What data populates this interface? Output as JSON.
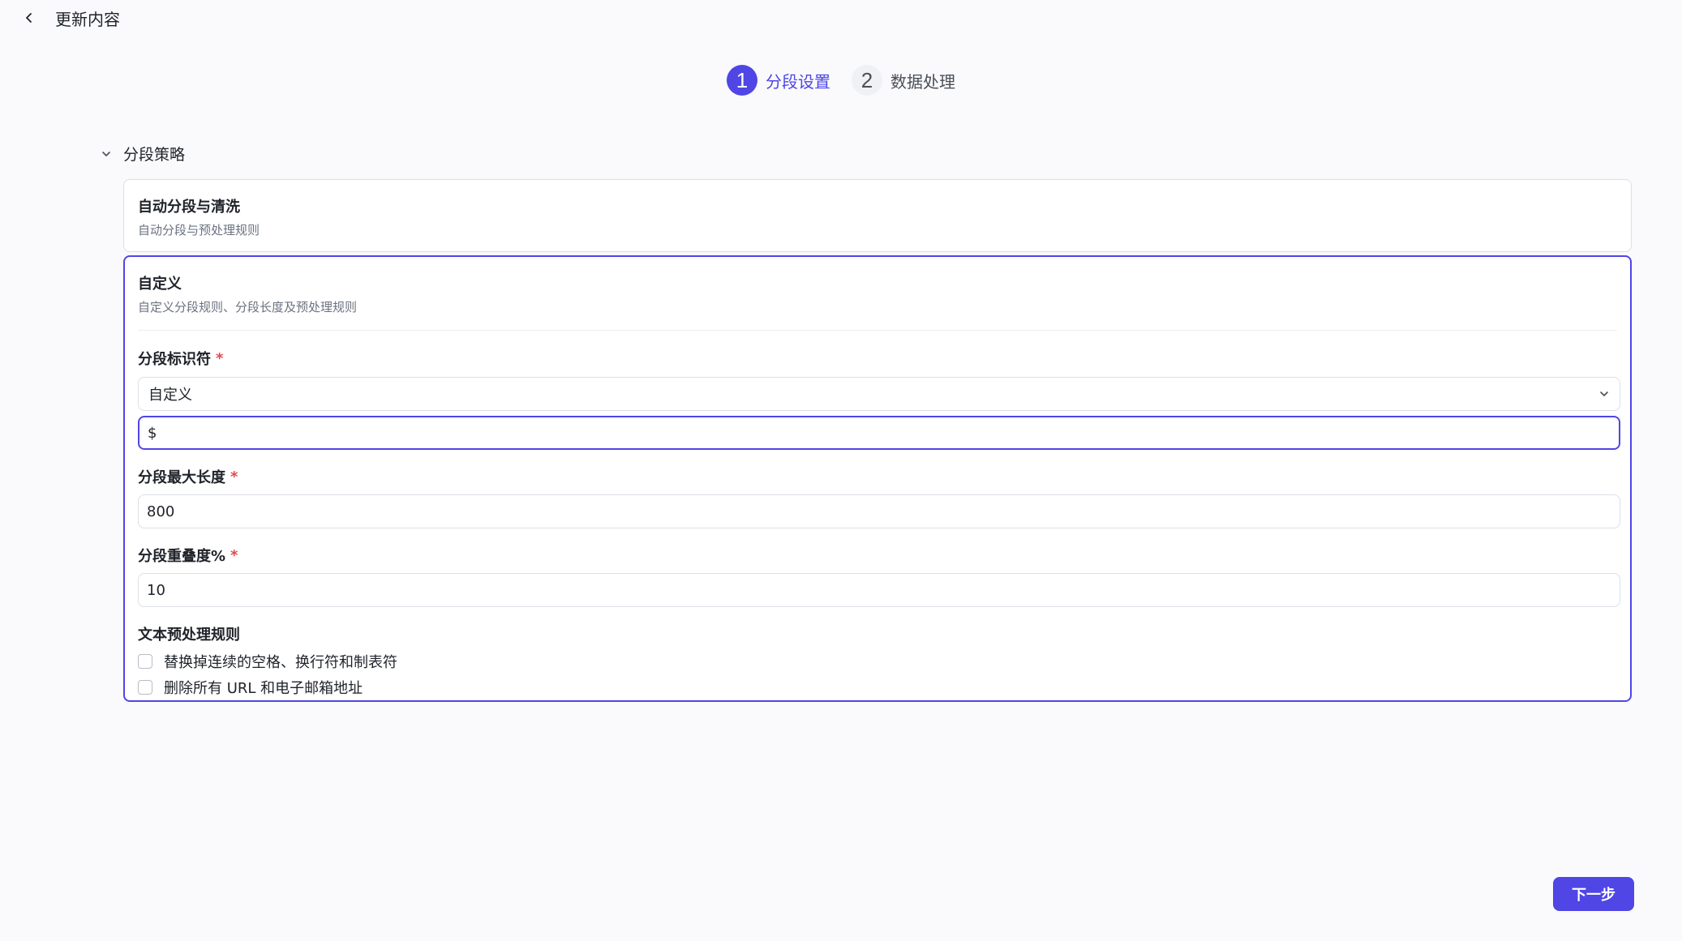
{
  "header": {
    "title": "更新内容"
  },
  "steps": [
    {
      "number": "1",
      "label": "分段设置",
      "state": "active"
    },
    {
      "number": "2",
      "label": "数据处理",
      "state": "inactive"
    }
  ],
  "section": {
    "title": "分段策略"
  },
  "options": {
    "auto": {
      "title": "自动分段与清洗",
      "description": "自动分段与预处理规则"
    },
    "custom": {
      "title": "自定义",
      "description": "自定义分段规则、分段长度及预处理规则",
      "separator": {
        "label": "分段标识符",
        "required_mark": "*",
        "selected": "自定义",
        "custom_value": "$"
      },
      "max_length": {
        "label": "分段最大长度",
        "required_mark": "*",
        "value": "800"
      },
      "overlap": {
        "label": "分段重叠度%",
        "required_mark": "*",
        "value": "10"
      },
      "preprocess": {
        "label": "文本预处理规则",
        "rules": [
          {
            "label": "替换掉连续的空格、换行符和制表符",
            "checked": false
          },
          {
            "label": "删除所有 URL 和电子邮箱地址",
            "checked": false
          }
        ]
      }
    }
  },
  "footer": {
    "next_label": "下一步"
  },
  "colors": {
    "accent": "#4f46e5",
    "required": "#e5484d",
    "border": "#dcdfe6",
    "background": "#fafafc"
  },
  "icons": {
    "back": "chevron-left-icon",
    "collapse": "chevron-down-icon",
    "select": "chevron-down-icon"
  }
}
